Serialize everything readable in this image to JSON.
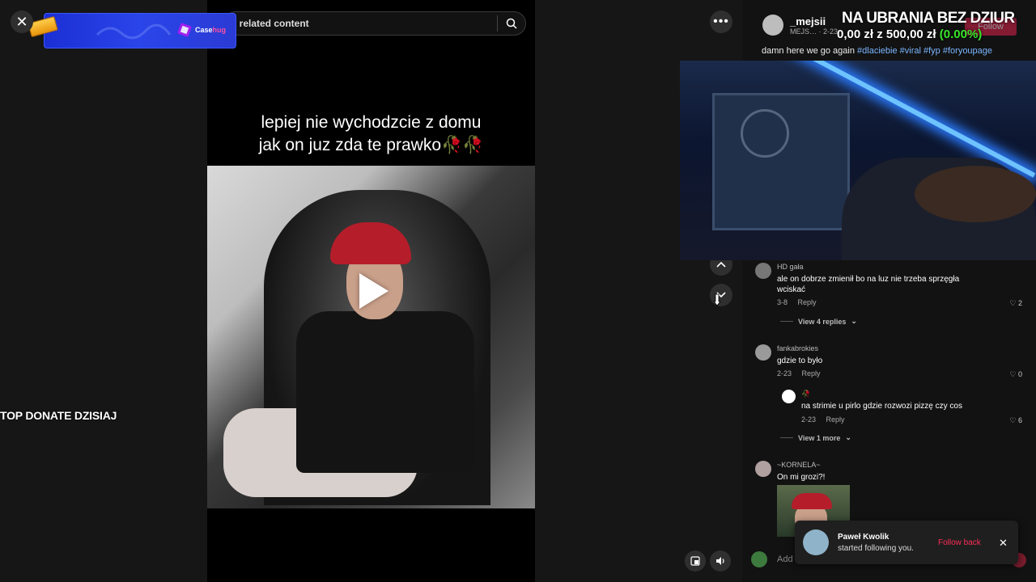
{
  "search": {
    "value": "d related content"
  },
  "banner": {
    "brand_case": "Case",
    "brand_hug": "hug"
  },
  "left": {
    "top_donate": "TOP DONATE DZISIAJ"
  },
  "video": {
    "caption_line1": "lepiej nie wychodzcie z domu",
    "caption_line2": "jak on juz zda te prawko🥀🥀"
  },
  "author": {
    "name": "_mejsii",
    "sub": "MEJS… · 2-23",
    "follow_label": "Follow"
  },
  "overlay": {
    "title": "NA UBRANIA BEZ DZIUR",
    "amount_current": "0,00 zł",
    "amount_of": "z",
    "amount_goal": "500,00 zł",
    "amount_pct": "(0.00%)"
  },
  "description": {
    "text": "damn here we go again",
    "tags": [
      "#dlaciebie",
      "#viral",
      "#fyp",
      "#foryoupage"
    ]
  },
  "comments": [
    {
      "user": "HD gała",
      "text": "ale on dobrze zmienił bo na luz nie trzeba sprzęgła wciskać",
      "date": "3-8",
      "reply": "Reply",
      "likes": "2",
      "view_replies": "View 4 replies"
    },
    {
      "user": "fankabrokies",
      "text": "gdzie to było",
      "date": "2-23",
      "reply": "Reply",
      "likes": "0"
    },
    {
      "user": "🥀",
      "text": "na strimie u pirlo gdzie rozwozi pizzę czy cos",
      "date": "2-23",
      "reply": "Reply",
      "likes": "6",
      "view_more": "View 1 more"
    },
    {
      "user": "~KORNELA~",
      "text": "On mi grozi?!"
    }
  ],
  "toast": {
    "name": "Paweł Kwolik",
    "sub": "started following you.",
    "follow_back": "Follow back",
    "close": "✕"
  },
  "add_comment": {
    "placeholder": "Add"
  },
  "icons": {
    "close": "close-icon",
    "more": "more-icon",
    "search": "search-icon",
    "up": "chevron-up-icon",
    "down": "chevron-down-icon",
    "heart": "heart-icon",
    "volume": "volume-icon",
    "pip": "pip-icon"
  },
  "colors": {
    "accent": "#fe2c55",
    "tag": "#7bb6ff",
    "pct": "#38e52b",
    "banner": "#2a45ea"
  }
}
